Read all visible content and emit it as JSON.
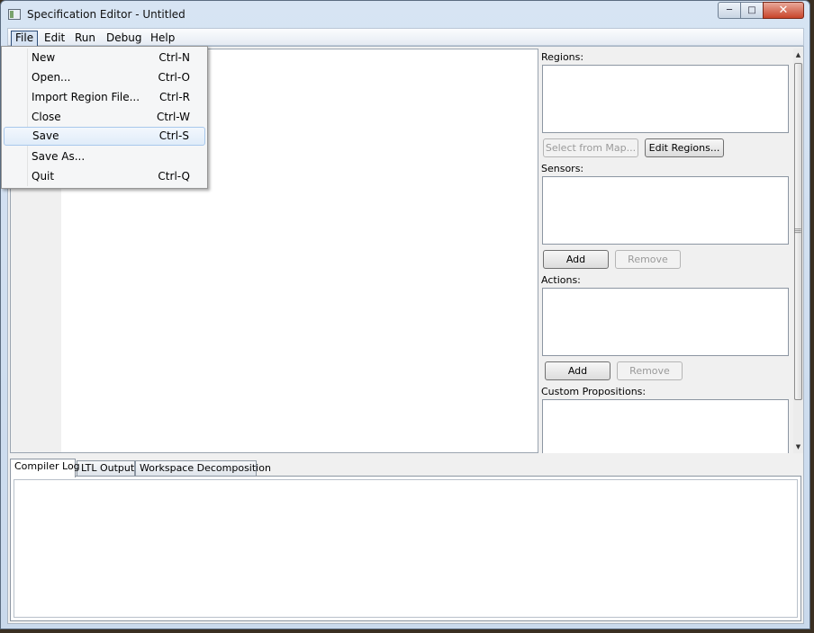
{
  "window": {
    "title": "Specification Editor - Untitled"
  },
  "menubar": {
    "items": [
      "File",
      "Edit",
      "Run",
      "Debug",
      "Help"
    ]
  },
  "file_menu": {
    "items": [
      {
        "label": "New",
        "shortcut": "Ctrl-N"
      },
      {
        "label": "Open...",
        "shortcut": "Ctrl-O"
      },
      {
        "label": "Import Region File...",
        "shortcut": "Ctrl-R"
      },
      {
        "label": "Close",
        "shortcut": "Ctrl-W"
      },
      {
        "label": "Save",
        "shortcut": "Ctrl-S"
      },
      {
        "label": "Save As...",
        "shortcut": ""
      },
      {
        "label": "Quit",
        "shortcut": "Ctrl-Q"
      }
    ],
    "highlighted": "Save"
  },
  "panel": {
    "regions_label": "Regions:",
    "select_from_map": "Select from Map...",
    "edit_regions": "Edit Regions...",
    "sensors_label": "Sensors:",
    "sensors_add": "Add",
    "sensors_remove": "Remove",
    "actions_label": "Actions:",
    "actions_add": "Add",
    "actions_remove": "Remove",
    "custom_label": "Custom Propositions:"
  },
  "tabs": [
    "Compiler Log",
    "LTL Output",
    "Workspace Decomposition"
  ],
  "selected_tab": "Compiler Log",
  "icons": {
    "minimize": "minimize-icon",
    "maximize": "maximize-icon",
    "close": "close-icon"
  }
}
